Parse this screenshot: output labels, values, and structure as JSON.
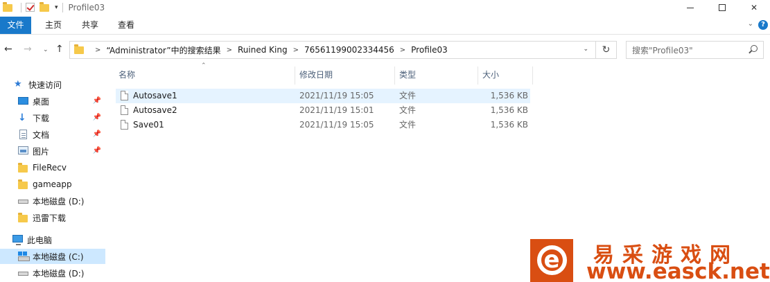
{
  "window": {
    "title": "Profile03",
    "qa_dropdown_glyph": "▾",
    "controls": {
      "close_glyph": "✕"
    }
  },
  "ribbon": {
    "tabs": [
      "文件",
      "主页",
      "共享",
      "查看"
    ],
    "collapse_glyph": "⌄",
    "help_glyph": "?"
  },
  "nav": {
    "back_glyph": "←",
    "forward_glyph": "→",
    "recent_glyph": "⌄",
    "up_glyph": "↑",
    "breadcrumb": [
      "“Administrator”中的搜索结果",
      "Ruined King",
      "76561199002334456",
      "Profile03"
    ],
    "breadcrumb_sep": ">",
    "address_dropdown_glyph": "⌄",
    "refresh_glyph": "↻",
    "search_placeholder": "搜索\"Profile03\""
  },
  "sidebar": {
    "quick_access": "快速访问",
    "items": [
      {
        "label": "桌面",
        "icon": "desktop-icon",
        "pinned": true
      },
      {
        "label": "下载",
        "icon": "download-icon",
        "pinned": true
      },
      {
        "label": "文档",
        "icon": "documents-icon",
        "pinned": true
      },
      {
        "label": "图片",
        "icon": "pictures-icon",
        "pinned": true
      },
      {
        "label": "FileRecv",
        "icon": "folder-icon",
        "pinned": false
      },
      {
        "label": "gameapp",
        "icon": "folder-icon",
        "pinned": false
      },
      {
        "label": "本地磁盘 (D:)",
        "icon": "drive-icon",
        "pinned": false
      },
      {
        "label": "迅雷下载",
        "icon": "folder-icon",
        "pinned": false
      }
    ],
    "this_pc": "此电脑",
    "pc_items": [
      {
        "label": "本地磁盘 (C:)",
        "icon": "windows-drive-icon",
        "selected": true
      },
      {
        "label": "本地磁盘 (D:)",
        "icon": "drive-icon",
        "selected": false
      }
    ],
    "pin_glyph": "📌"
  },
  "file_list": {
    "columns": {
      "name": "名称",
      "modified": "修改日期",
      "type": "类型",
      "size": "大小"
    },
    "sort_glyph": "⌃",
    "rows": [
      {
        "name": "Autosave1",
        "modified": "2021/11/19 15:05",
        "type": "文件",
        "size": "1,536 KB",
        "selected": true
      },
      {
        "name": "Autosave2",
        "modified": "2021/11/19 15:01",
        "type": "文件",
        "size": "1,536 KB",
        "selected": false
      },
      {
        "name": "Save01",
        "modified": "2021/11/19 15:05",
        "type": "文件",
        "size": "1,536 KB",
        "selected": false
      }
    ]
  },
  "watermark": {
    "logo_letter": "e",
    "brand_cn": "易采游戏网",
    "brand_url": "www.easck.net",
    "color": "#d94e12"
  },
  "colors": {
    "accent": "#1979ca",
    "selection": "#cde8ff",
    "row_hover": "#e5f3ff"
  }
}
